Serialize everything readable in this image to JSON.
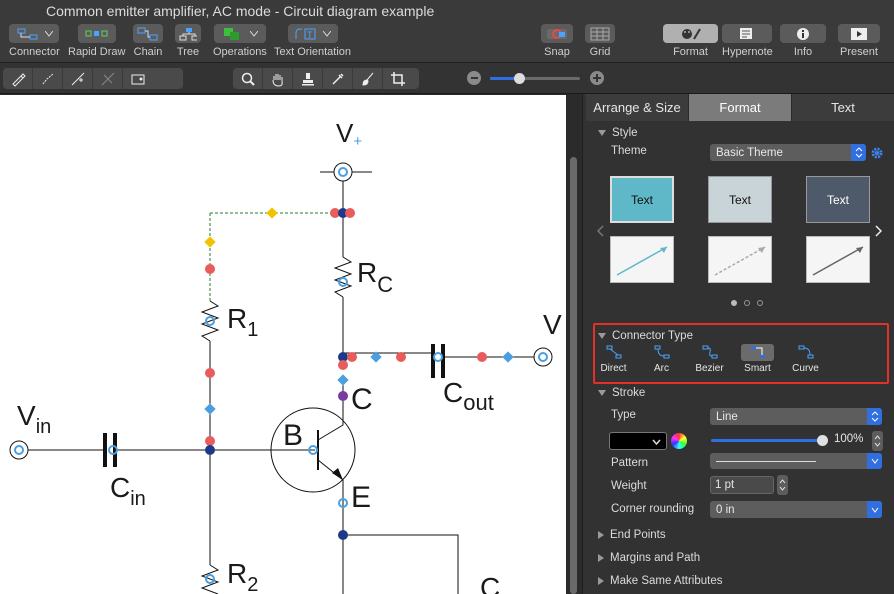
{
  "window": {
    "title": "Common emitter amplifier, AC mode - Circuit diagram example"
  },
  "toolbar": {
    "connector": "Connector",
    "rapid_draw": "Rapid Draw",
    "chain": "Chain",
    "tree": "Tree",
    "operations": "Operations",
    "text_orientation": "Text Orientation",
    "snap": "Snap",
    "grid": "Grid",
    "format": "Format",
    "hypernote": "Hypernote",
    "info": "Info",
    "present": "Present"
  },
  "canvas": {
    "labels": {
      "vplus_main": "V",
      "vplus_sub": "+",
      "rc_main": "R",
      "rc_sub": "C",
      "r1_main": "R",
      "r1_sub": "1",
      "vout_main": "V",
      "c_label": "C",
      "cout_main": "C",
      "cout_sub": "out",
      "vin_main": "V",
      "vin_sub": "in",
      "b_label": "B",
      "cin_main": "C",
      "cin_sub": "in",
      "e_label": "E",
      "r2_main": "R",
      "r2_sub": "2",
      "c_bottom": "C"
    }
  },
  "inspector": {
    "tabs": [
      "Arrange & Size",
      "Format",
      "Text"
    ],
    "active_tab": "Format",
    "style": {
      "header": "Style",
      "theme_label": "Theme",
      "theme_value": "Basic Theme",
      "theme_cards": [
        "Text",
        "Text",
        "Text"
      ]
    },
    "connector_type": {
      "header": "Connector Type",
      "options": [
        "Direct",
        "Arc",
        "Bezier",
        "Smart",
        "Curve"
      ],
      "selected": "Smart"
    },
    "stroke": {
      "header": "Stroke",
      "type_label": "Type",
      "type_value": "Line",
      "opacity": "100%",
      "opacity_fraction": 1.0,
      "pattern_label": "Pattern",
      "weight_label": "Weight",
      "weight_value": "1 pt",
      "corner_label": "Corner rounding",
      "corner_value": "0 in"
    },
    "sections": {
      "end_points": "End Points",
      "margins": "Margins and Path",
      "same_attrs": "Make Same Attributes"
    }
  },
  "colors": {
    "accent_blue": "#2f6fe0",
    "highlight_red": "#e0312b",
    "handle_red": "#e85c5c",
    "handle_blue": "#4a9fe0",
    "handle_yellow": "#f2c200",
    "theme_teal": "#5fb8c8"
  }
}
